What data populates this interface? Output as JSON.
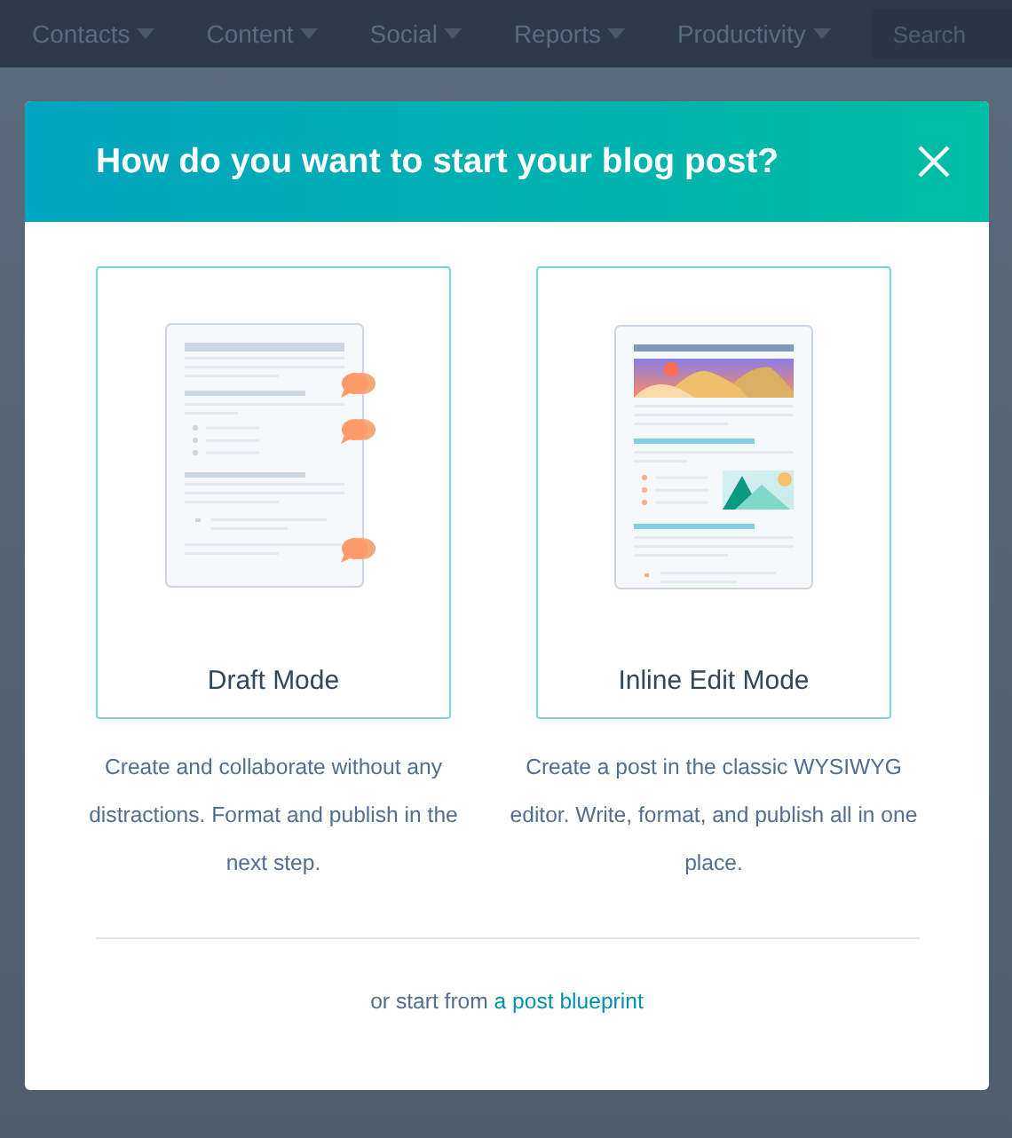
{
  "nav": {
    "items": [
      {
        "label": "Contacts"
      },
      {
        "label": "Content"
      },
      {
        "label": "Social"
      },
      {
        "label": "Reports"
      },
      {
        "label": "Productivity"
      }
    ],
    "search": {
      "placeholder": "Search"
    }
  },
  "modal": {
    "title": "How do you want to start your blog post?",
    "options": [
      {
        "kind": "draft",
        "label": "Draft Mode",
        "description": "Create and collaborate without any distractions. Format and publish in the next step."
      },
      {
        "kind": "inline",
        "label": "Inline Edit Mode",
        "description": "Create a post in the classic WYSIWYG editor. Write, format, and publish all in one place."
      }
    ],
    "footer": {
      "text": "or start from",
      "link": "a post blueprint"
    }
  }
}
